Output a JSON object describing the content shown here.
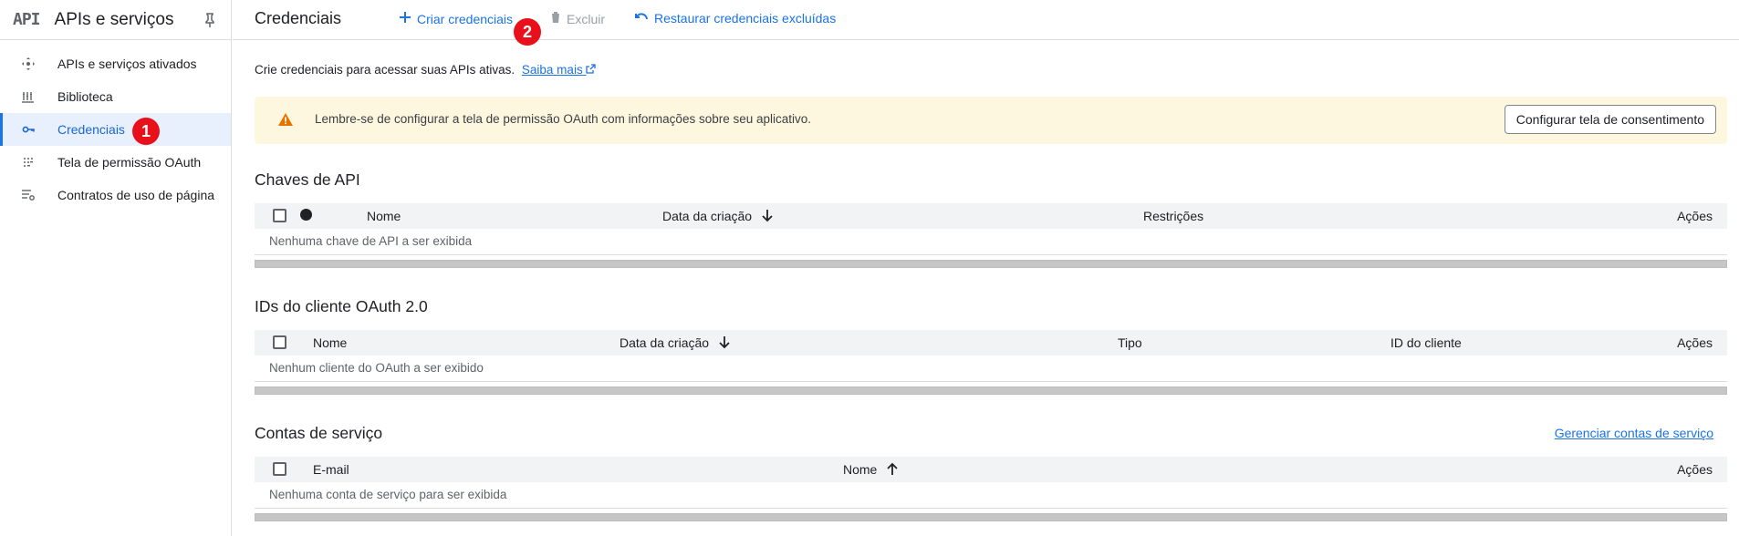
{
  "sidebar": {
    "logo": "API",
    "title": "APIs e serviços",
    "items": [
      {
        "label": "APIs e serviços ativados",
        "icon": "diamond-arrows-icon"
      },
      {
        "label": "Biblioteca",
        "icon": "library-icon"
      },
      {
        "label": "Credenciais",
        "icon": "key-icon",
        "active": true
      },
      {
        "label": "Tela de permissão OAuth",
        "icon": "dotted-grid-icon"
      },
      {
        "label": "Contratos de uso de página",
        "icon": "list-settings-icon"
      }
    ]
  },
  "badges": {
    "one": "1",
    "two": "2"
  },
  "topbar": {
    "title": "Credenciais",
    "create": "Criar credenciais",
    "delete": "Excluir",
    "restore": "Restaurar credenciais excluídas"
  },
  "intro": {
    "text": "Crie credenciais para acessar suas APIs ativas.",
    "link": "Saiba mais"
  },
  "banner": {
    "message": "Lembre-se de configurar a tela de permissão OAuth com informações sobre seu aplicativo.",
    "button": "Configurar tela de consentimento"
  },
  "api_keys": {
    "title": "Chaves de API",
    "columns": [
      "Nome",
      "Data da criação",
      "Restrições",
      "Ações"
    ],
    "empty": "Nenhuma chave de API a ser exibida"
  },
  "oauth": {
    "title": "IDs do cliente OAuth 2.0",
    "columns": [
      "Nome",
      "Data da criação",
      "Tipo",
      "ID do cliente",
      "Ações"
    ],
    "empty": "Nenhum cliente do OAuth a ser exibido"
  },
  "service_accounts": {
    "title": "Contas de serviço",
    "manage": "Gerenciar contas de serviço",
    "columns": [
      "E-mail",
      "Nome",
      "Ações"
    ],
    "empty": "Nenhuma conta de serviço para ser exibida"
  },
  "colors": {
    "accent": "#1a73e8",
    "badge": "#e8101a",
    "banner_bg": "#fef7e0",
    "warning": "#e37400"
  }
}
